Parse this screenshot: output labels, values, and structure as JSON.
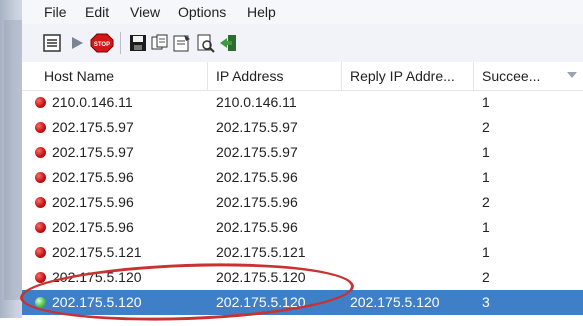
{
  "menu": [
    "File",
    "Edit",
    "View",
    "Options",
    "Help"
  ],
  "toolbar": {
    "icons": [
      "list-icon",
      "play-icon",
      "stop-icon",
      "save-icon",
      "copy-icon",
      "properties-icon",
      "find-icon",
      "exit-icon"
    ],
    "stop_label": "STOP"
  },
  "columns": [
    "Host Name",
    "IP Address",
    "Reply IP Addre...",
    "Succee..."
  ],
  "rows": [
    {
      "host": "210.0.146.11",
      "ip": "210.0.146.11",
      "reply": "",
      "succ": "1",
      "status": "red"
    },
    {
      "host": "202.175.5.97",
      "ip": "202.175.5.97",
      "reply": "",
      "succ": "2",
      "status": "red"
    },
    {
      "host": "202.175.5.97",
      "ip": "202.175.5.97",
      "reply": "",
      "succ": "1",
      "status": "red"
    },
    {
      "host": "202.175.5.96",
      "ip": "202.175.5.96",
      "reply": "",
      "succ": "1",
      "status": "red"
    },
    {
      "host": "202.175.5.96",
      "ip": "202.175.5.96",
      "reply": "",
      "succ": "2",
      "status": "red"
    },
    {
      "host": "202.175.5.96",
      "ip": "202.175.5.96",
      "reply": "",
      "succ": "1",
      "status": "red"
    },
    {
      "host": "202.175.5.121",
      "ip": "202.175.5.121",
      "reply": "",
      "succ": "1",
      "status": "red"
    },
    {
      "host": "202.175.5.120",
      "ip": "202.175.5.120",
      "reply": "",
      "succ": "2",
      "status": "red"
    },
    {
      "host": "202.175.5.120",
      "ip": "202.175.5.120",
      "reply": "202.175.5.120",
      "succ": "3",
      "status": "green"
    }
  ],
  "colors": {
    "selection": "#3e7fc8",
    "status_red": "#c21515",
    "status_green": "#4fc04f",
    "annotation": "#c83232"
  }
}
